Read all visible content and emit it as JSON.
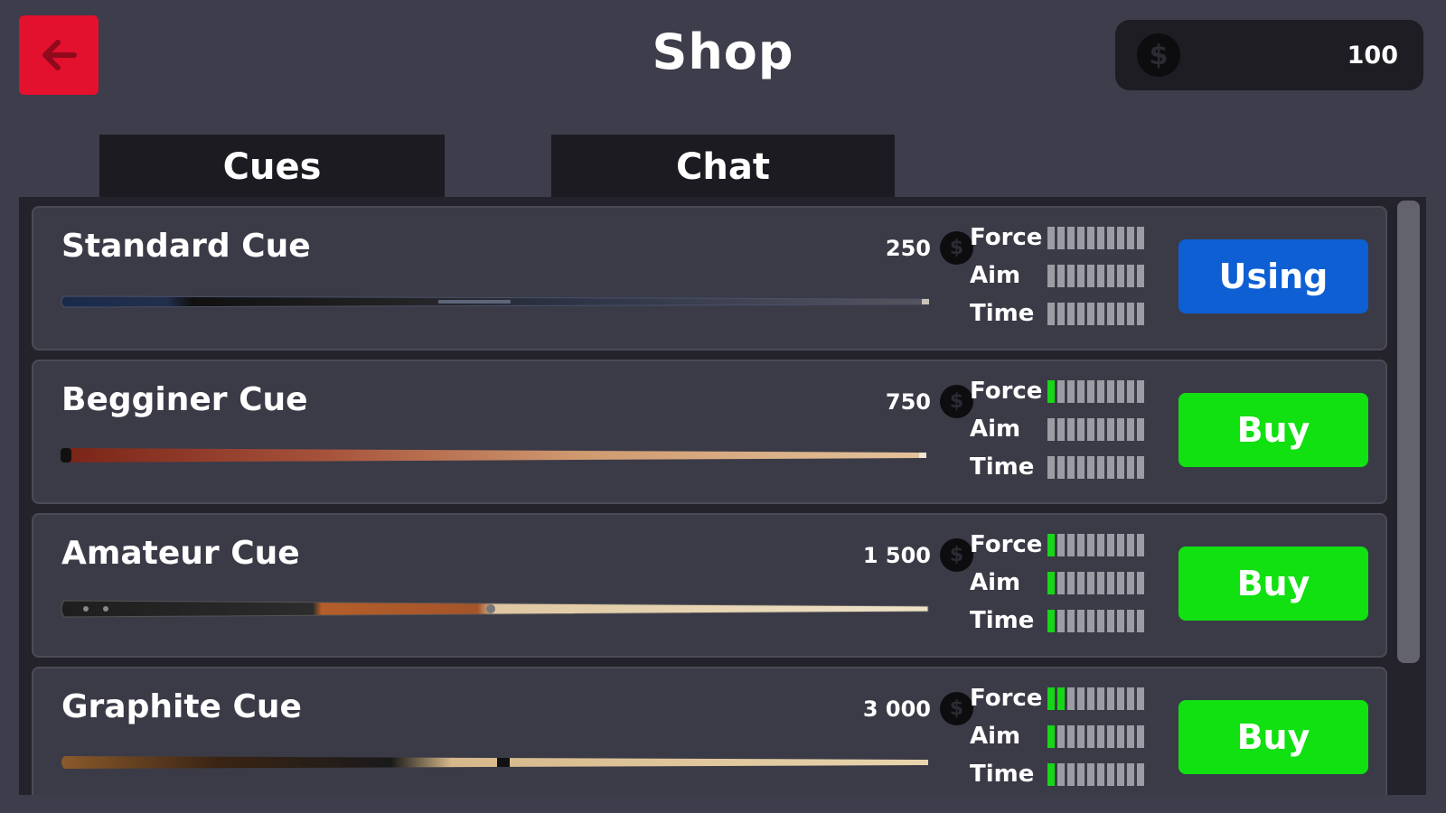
{
  "header": {
    "title": "Shop",
    "coins": "100",
    "coin_symbol": "$"
  },
  "tabs": [
    {
      "label": "Cues"
    },
    {
      "label": "Chat"
    }
  ],
  "stat_labels": [
    "Force",
    "Aim",
    "Time"
  ],
  "cues": [
    {
      "name": "Standard Cue",
      "price": "250",
      "action": "Using",
      "force": 0,
      "aim": 0,
      "time": 0
    },
    {
      "name": "Begginer Cue",
      "price": "750",
      "action": "Buy",
      "force": 1,
      "aim": 0,
      "time": 0
    },
    {
      "name": "Amateur Cue",
      "price": "1 500",
      "action": "Buy",
      "force": 1,
      "aim": 1,
      "time": 1
    },
    {
      "name": "Graphite Cue",
      "price": "3 000",
      "action": "Buy",
      "force": 2,
      "aim": 1,
      "time": 1
    }
  ],
  "stat_max": 10,
  "colors": {
    "back_button": "#e3102e",
    "using_button": "#0d5fd3",
    "buy_button": "#11e011",
    "stat_on": "#16d616",
    "stat_off": "#9c9ca4"
  }
}
